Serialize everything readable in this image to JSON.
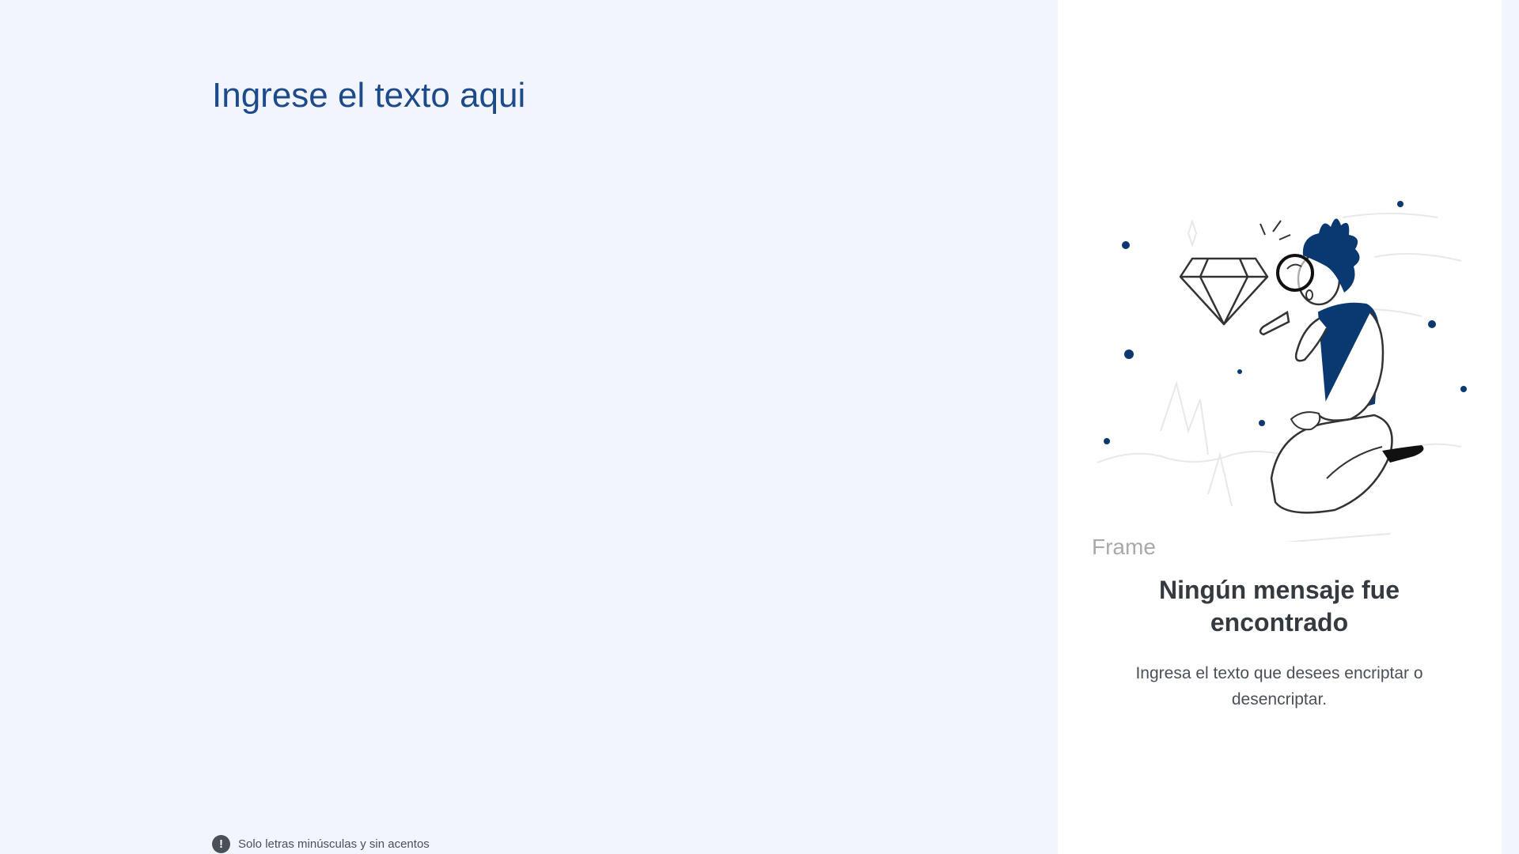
{
  "input": {
    "placeholder": "Ingrese el texto aqui",
    "value": ""
  },
  "hint": {
    "icon": "info-circle-icon",
    "icon_glyph": "!",
    "text": "Solo letras minúsculas y sin acentos"
  },
  "output": {
    "illustration": "person-with-magnifying-glass-looking-at-diamond",
    "frame_label": "Frame",
    "empty_title": "Ningún mensaje fue encontrado",
    "empty_description": "Ingresa el texto que desees encriptar o desencriptar."
  },
  "colors": {
    "background": "#f2f5fd",
    "accent": "#0a3871",
    "panel": "#ffffff",
    "text_dark": "#343a40",
    "text_muted": "#495057"
  }
}
